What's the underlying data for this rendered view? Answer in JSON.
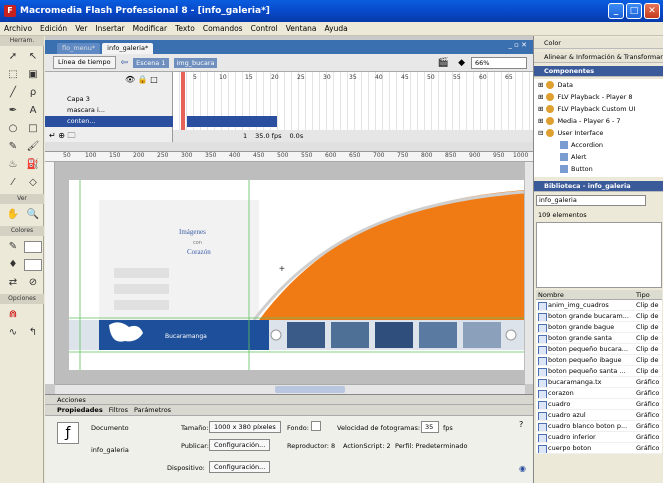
{
  "app": {
    "logo": "F",
    "title": "Macromedia Flash Professional 8 - [info_galeria*]"
  },
  "window_buttons": {
    "minimize": "_",
    "maximize": "□",
    "close": "✕"
  },
  "menubar": [
    "Archivo",
    "Edición",
    "Ver",
    "Insertar",
    "Modificar",
    "Texto",
    "Comandos",
    "Control",
    "Ventana",
    "Ayuda"
  ],
  "tools": {
    "header_tools": "Herram.",
    "header_view": "Ver",
    "header_colors": "Colores",
    "header_options": "Opciones"
  },
  "doc_tabs": [
    {
      "label": "flo_menu*"
    },
    {
      "label": "info_galeria*"
    }
  ],
  "doc_controls": "_ ▫ ✕",
  "editbar": {
    "timeline_button": "Línea de tiempo",
    "scene": "Escena 1",
    "symbol": "img_bucara",
    "zoom": "66%"
  },
  "timeline": {
    "layers": [
      {
        "name": "Capa 3",
        "selected": false
      },
      {
        "name": "mascara i...",
        "selected": false
      },
      {
        "name": "conten...",
        "selected": true
      }
    ],
    "ruler": [
      "5",
      "10",
      "15",
      "20",
      "25",
      "30",
      "35",
      "40",
      "45",
      "50",
      "55",
      "60",
      "65"
    ],
    "status": {
      "frame": "1",
      "fps": "35.0 fps",
      "time": "0.0s"
    }
  },
  "hruler_marks": [
    "50",
    "100",
    "150",
    "200",
    "250",
    "300",
    "350",
    "400",
    "450",
    "500",
    "550",
    "600",
    "650",
    "700",
    "750",
    "800",
    "850",
    "900",
    "950",
    "1000"
  ],
  "stage_content": {
    "heading": "Imágenes",
    "connector": "con",
    "subheading": "Corazón",
    "banner_label": "Bucaramanga",
    "accent_color": "#f07a14"
  },
  "actions_bar": "Acciones",
  "props_tabs": [
    "Propiedades",
    "Filtros",
    "Parámetros"
  ],
  "props": {
    "type": "Documento",
    "name": "info_galeria",
    "size_label": "Tamaño:",
    "size_value": "1000 x 380 píxeles",
    "bg_label": "Fondo:",
    "fps_label": "Velocidad de fotogramas:",
    "fps_value": "35",
    "fps_unit": "fps",
    "publish_label": "Publicar:",
    "publish_button": "Configuración...",
    "player": "Reproductor: 8",
    "actionscript": "ActionScript: 2",
    "profile": "Perfil: Predeterminado",
    "device_label": "Dispositivo:",
    "device_button": "Configuración..."
  },
  "right_panel": {
    "color": "Color",
    "align": "Alinear & Información & Transformar",
    "components": "Componentes",
    "tree": [
      {
        "label": "Data",
        "level": 0
      },
      {
        "label": "FLV Playback - Player 8",
        "level": 0
      },
      {
        "label": "FLV Playback Custom UI",
        "level": 0
      },
      {
        "label": "Media - Player 6 - 7",
        "level": 0
      },
      {
        "label": "User Interface",
        "level": 0
      },
      {
        "label": "Accordion",
        "level": 1
      },
      {
        "label": "Alert",
        "level": 1
      },
      {
        "label": "Button",
        "level": 1
      }
    ],
    "library_title": "Biblioteca - info_galeria",
    "library_select": "info_galeria",
    "library_count": "109 elementos",
    "columns": {
      "name": "Nombre",
      "type": "Tipo"
    },
    "items": [
      {
        "name": "anim_img_cuadros",
        "type": "Clip de"
      },
      {
        "name": "boton grande bucaram...",
        "type": "Clip de"
      },
      {
        "name": "boton grande bague",
        "type": "Clip de"
      },
      {
        "name": "boton grande santa",
        "type": "Clip de"
      },
      {
        "name": "boton pequeño bucara...",
        "type": "Clip de"
      },
      {
        "name": "boton pequeño ibague",
        "type": "Clip de"
      },
      {
        "name": "boton pequeño santa ...",
        "type": "Clip de"
      },
      {
        "name": "bucaramanga.tx",
        "type": "Gráfico"
      },
      {
        "name": "corazon",
        "type": "Gráfico"
      },
      {
        "name": "cuadro",
        "type": "Gráfico"
      },
      {
        "name": "cuadro azul",
        "type": "Gráfico"
      },
      {
        "name": "cuadro blanco boton p...",
        "type": "Gráfico"
      },
      {
        "name": "cuadro inferior",
        "type": "Gráfico"
      },
      {
        "name": "cuerpo boton",
        "type": "Gráfico"
      }
    ]
  }
}
